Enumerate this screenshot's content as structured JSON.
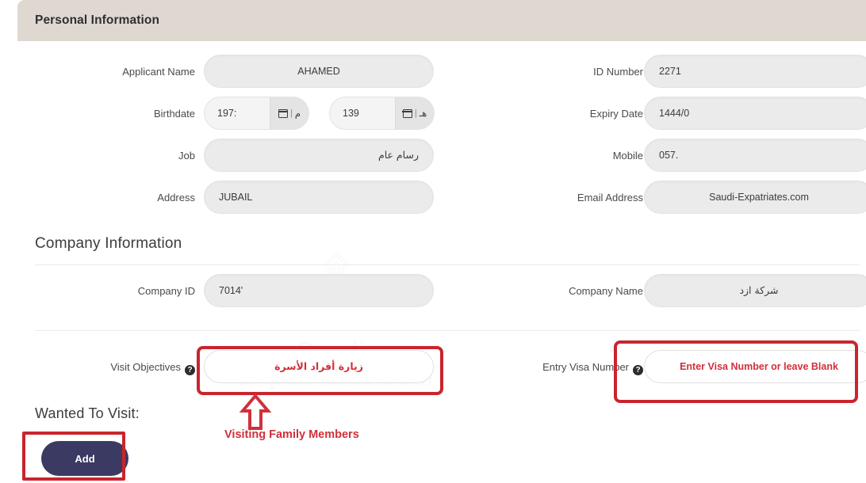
{
  "card": {
    "header_title": "Personal Information"
  },
  "watermark": {
    "emblem_glyph": "۩",
    "text": "Saudi-Expatriates.com"
  },
  "personal": {
    "fields": [
      {
        "label": "Applicant Name",
        "value": "AHAMED"
      },
      {
        "label": "ID Number",
        "value": "2271"
      },
      {
        "label": "Birthdate",
        "value": ""
      },
      {
        "label": "Expiry Date",
        "value": "1444/0"
      },
      {
        "label": "Job",
        "value": "رسام عام"
      },
      {
        "label": "Mobile",
        "value": "057."
      },
      {
        "label": "Address",
        "value": "JUBAIL"
      },
      {
        "label": "Email Address",
        "value": "Saudi-Expatriates.com"
      }
    ],
    "birthdate": {
      "gregorian_value": "197:",
      "gregorian_suffix": "م",
      "hijri_value": "139",
      "hijri_suffix": "هـ",
      "separator": "|",
      "calendar_icon": "calendar-icon"
    }
  },
  "company": {
    "heading": "Company Information",
    "id_label": "Company ID",
    "id_value": "7014'",
    "name_label": "Company Name",
    "name_value": "شركة ازد"
  },
  "visit": {
    "objectives_label": "Visit Objectives",
    "objectives_value": "زيارة أفراد الأسرة",
    "visa_label": "Entry Visa Number",
    "visa_placeholder": "Enter Visa Number or leave Blank",
    "help_glyph": "?",
    "wanted_heading": "Wanted To Visit:",
    "add_label": "Add"
  },
  "annotations": {
    "caption": "Visiting Family Members",
    "color": "#d1303a",
    "box_color": "#c9252d"
  }
}
